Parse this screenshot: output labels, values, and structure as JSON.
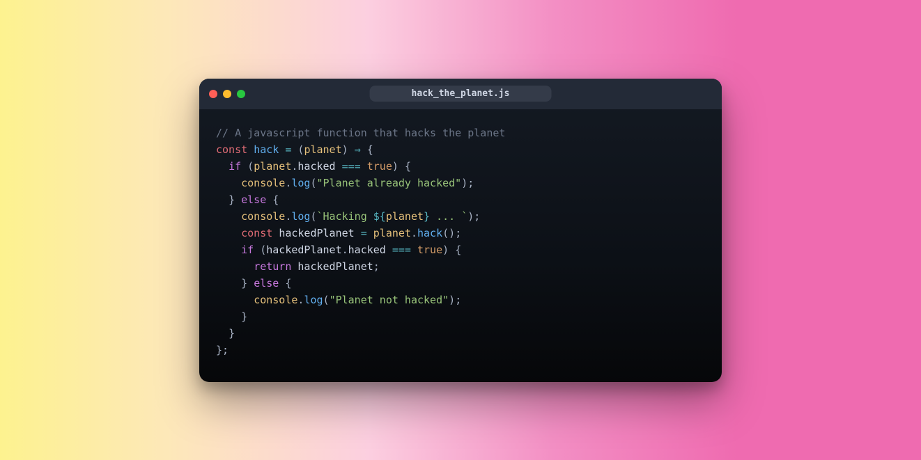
{
  "filename": "hack_the_planet.js",
  "colors": {
    "red": "#ff5f57",
    "yellow": "#febc2e",
    "green": "#28c840"
  },
  "code": {
    "comment": "// A javascript function that hacks the planet",
    "kw_const": "const",
    "fn_hack": "hack",
    "param": "planet",
    "arrow": "⇒",
    "kw_if": "if",
    "kw_else": "else",
    "kw_return": "return",
    "prop_hacked": "hacked",
    "eq": "===",
    "bool_true": "true",
    "obj_console": "console",
    "fn_log": "log",
    "str_already": "\"Planet already hacked\"",
    "str_hacking_open": "`Hacking ",
    "str_hacking_interp_open": "${",
    "str_hacking_interp_var": "planet",
    "str_hacking_interp_close": "}",
    "str_hacking_tail": " ... `",
    "var_hacked": "hackedPlanet",
    "fn_hack_call": "hack",
    "str_not": "\"Planet not hacked\""
  }
}
